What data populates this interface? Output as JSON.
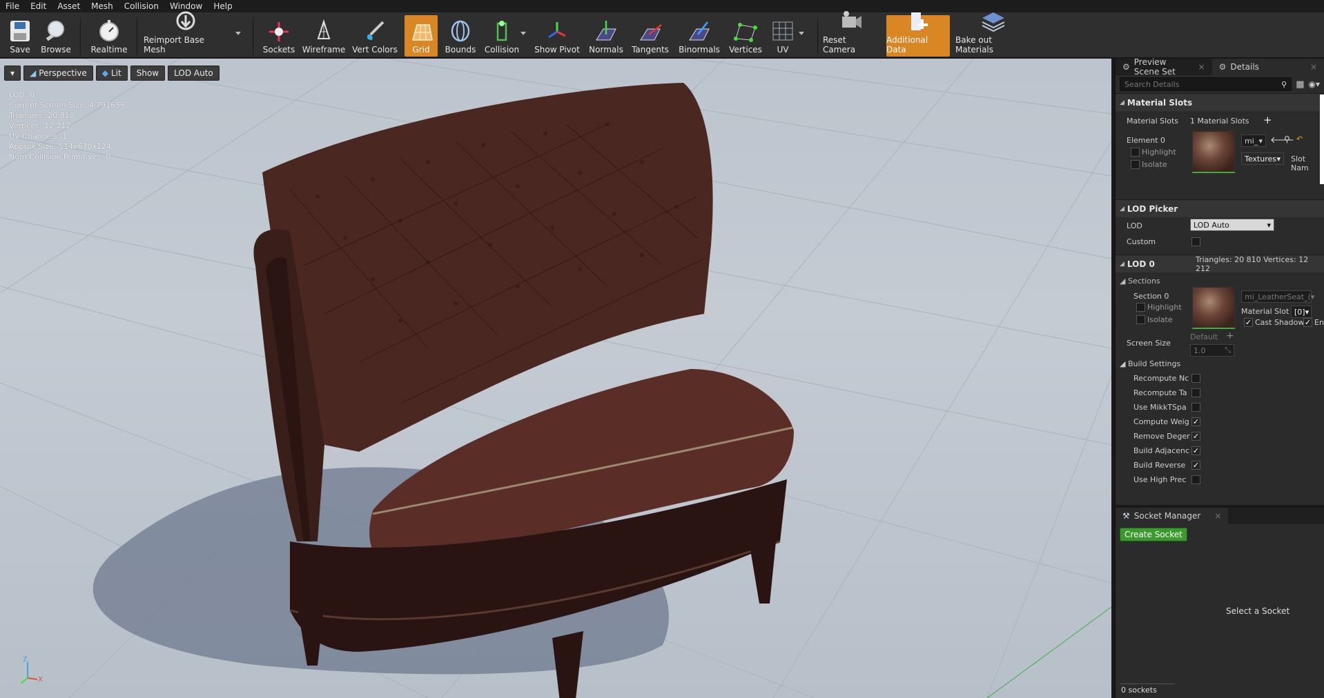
{
  "menu": [
    "File",
    "Edit",
    "Asset",
    "Mesh",
    "Collision",
    "Window",
    "Help"
  ],
  "toolbar": {
    "save": "Save",
    "browse": "Browse",
    "realtime": "Realtime",
    "reimport": "Reimport Base Mesh",
    "sockets": "Sockets",
    "wireframe": "Wireframe",
    "vert_colors": "Vert Colors",
    "grid": "Grid",
    "bounds": "Bounds",
    "collision": "Collision",
    "show_pivot": "Show Pivot",
    "normals": "Normals",
    "tangents": "Tangents",
    "binormals": "Binormals",
    "vertices": "Vertices",
    "uv": "UV",
    "reset_camera": "Reset Camera",
    "additional_data": "Additional Data",
    "bake_materials": "Bake out Materials",
    "active_color": "#d98624"
  },
  "viewport": {
    "perspective": "Perspective",
    "lit": "Lit",
    "show": "Show",
    "lod": "LOD Auto",
    "stats": [
      "LOD:  0",
      "Current Screen Size:  4.791656",
      "Triangles:  20 810",
      "Vertices:  12 212",
      "UV Channels:  1",
      "Approx Size: 514x670x124",
      "Num Collision Primitives:  0"
    ],
    "axis": {
      "x": "X",
      "z": "Z"
    }
  },
  "details": {
    "tab_preview": "Preview Scene Set",
    "tab_details": "Details",
    "search_placeholder": "Search Details",
    "material_slots": {
      "header": "Material Slots",
      "label": "Material Slots",
      "value": "1 Material Slots",
      "element": "Element 0",
      "highlight": "Highlight",
      "isolate": "Isolate",
      "material_name": "mi_",
      "textures": "Textures",
      "slot_name": "Slot Nam"
    },
    "lod_picker": {
      "header": "LOD Picker",
      "lod_label": "LOD",
      "lod_value": "LOD Auto",
      "custom_label": "Custom"
    },
    "lod0": {
      "header": "LOD 0",
      "info": "Triangles: 20 810    Vertices: 12 212",
      "sections": "Sections",
      "section0": "Section 0",
      "highlight": "Highlight",
      "isolate": "Isolate",
      "material": "mi_LeatherSeat_(",
      "material_slot": "Material Slot",
      "slot_value": "[0]",
      "cast_shadow": "Cast Shadow",
      "enable": "Ena",
      "screen_size": "Screen Size",
      "default": "Default",
      "screen_value": "1.0",
      "build_settings": "Build Settings",
      "build_rows": [
        {
          "label": "Recompute Nc",
          "checked": false
        },
        {
          "label": "Recompute Ta",
          "checked": false
        },
        {
          "label": "Use MikkTSpa",
          "checked": false
        },
        {
          "label": "Compute Weig",
          "checked": true
        },
        {
          "label": "Remove Deger",
          "checked": true
        },
        {
          "label": "Build Adjacenc",
          "checked": true
        },
        {
          "label": "Build Reverse",
          "checked": true
        },
        {
          "label": "Use High Prec",
          "checked": false
        }
      ]
    }
  },
  "socket_manager": {
    "tab": "Socket Manager",
    "create": "Create Socket",
    "empty": "Select a Socket",
    "count": "0 sockets"
  }
}
